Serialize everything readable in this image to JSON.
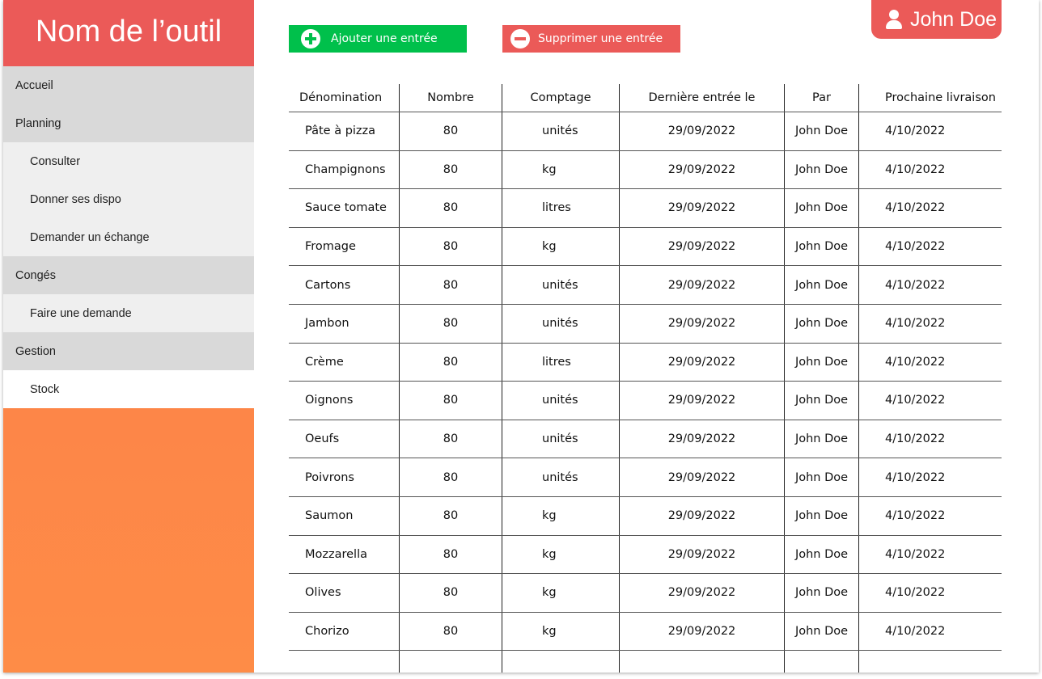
{
  "app": {
    "title": "Nom de l’outil"
  },
  "sidebar": {
    "items": [
      {
        "label": "Accueil",
        "kind": "section"
      },
      {
        "label": "Planning",
        "kind": "section"
      },
      {
        "label": "Consulter",
        "kind": "sub"
      },
      {
        "label": "Donner ses dispo",
        "kind": "sub"
      },
      {
        "label": "Demander un échange",
        "kind": "sub"
      },
      {
        "label": "Congés",
        "kind": "section"
      },
      {
        "label": "Faire une demande",
        "kind": "sub"
      },
      {
        "label": "Gestion",
        "kind": "section"
      },
      {
        "label": "Stock",
        "kind": "sub",
        "active": true
      }
    ]
  },
  "toolbar": {
    "add_label": "Ajouter une entrée",
    "delete_label": "Supprimer une entrée"
  },
  "user": {
    "name": "John Doe",
    "icon": "user-icon"
  },
  "colors": {
    "brand": "#eb5a58",
    "add": "#00c04b",
    "sidebar_gradient_top": "#fb7c49",
    "sidebar_gradient_bottom": "#fe8c47"
  },
  "table": {
    "columns": [
      "Dénomination",
      "Nombre",
      "Comptage",
      "Dernière entrée le",
      "Par",
      "Prochaine livraison"
    ],
    "rows": [
      [
        "Pâte à pizza",
        "80",
        "unités",
        "29/09/2022",
        "John Doe",
        "4/10/2022"
      ],
      [
        "Champignons",
        "80",
        "kg",
        "29/09/2022",
        "John Doe",
        "4/10/2022"
      ],
      [
        "Sauce tomate",
        "80",
        "litres",
        "29/09/2022",
        "John Doe",
        "4/10/2022"
      ],
      [
        "Fromage",
        "80",
        "kg",
        "29/09/2022",
        "John Doe",
        "4/10/2022"
      ],
      [
        "Cartons",
        "80",
        "unités",
        "29/09/2022",
        "John Doe",
        "4/10/2022"
      ],
      [
        "Jambon",
        "80",
        "unités",
        "29/09/2022",
        "John Doe",
        "4/10/2022"
      ],
      [
        "Crème",
        "80",
        "litres",
        "29/09/2022",
        "John Doe",
        "4/10/2022"
      ],
      [
        "Oignons",
        "80",
        "unités",
        "29/09/2022",
        "John Doe",
        "4/10/2022"
      ],
      [
        "Oeufs",
        "80",
        "unités",
        "29/09/2022",
        "John Doe",
        "4/10/2022"
      ],
      [
        "Poivrons",
        "80",
        "unités",
        "29/09/2022",
        "John Doe",
        "4/10/2022"
      ],
      [
        "Saumon",
        "80",
        "kg",
        "29/09/2022",
        "John Doe",
        "4/10/2022"
      ],
      [
        "Mozzarella",
        "80",
        "kg",
        "29/09/2022",
        "John Doe",
        "4/10/2022"
      ],
      [
        "Olives",
        "80",
        "kg",
        "29/09/2022",
        "John Doe",
        "4/10/2022"
      ],
      [
        "Chorizo",
        "80",
        "kg",
        "29/09/2022",
        "John Doe",
        "4/10/2022"
      ]
    ]
  }
}
